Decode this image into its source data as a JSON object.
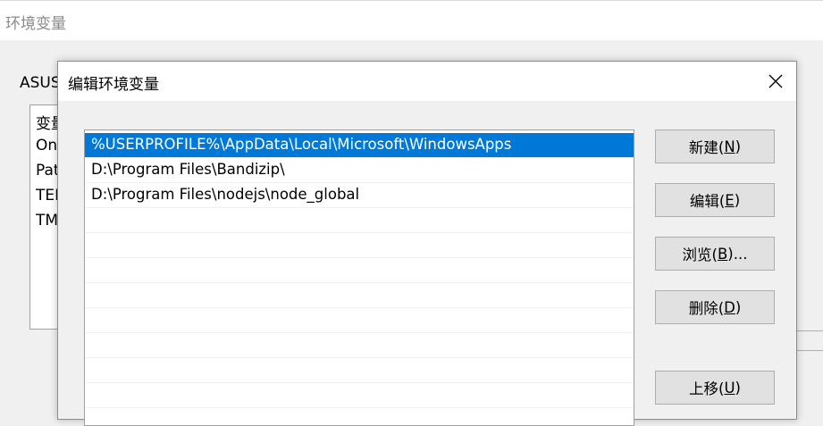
{
  "background_window": {
    "title": "环境变量",
    "user_section_label": "ASUS",
    "list_rows": [
      "变量",
      "On",
      "Pat",
      "TEI",
      "TM"
    ]
  },
  "dialog": {
    "title": "编辑环境变量",
    "paths": [
      "%USERPROFILE%\\AppData\\Local\\Microsoft\\WindowsApps",
      "D:\\Program Files\\Bandizip\\",
      "D:\\Program Files\\nodejs\\node_global"
    ],
    "selected_index": 0,
    "empty_rows": 8,
    "buttons": {
      "new": {
        "label": "新建(",
        "key": "N",
        "suffix": ")"
      },
      "edit": {
        "label": "编辑(",
        "key": "E",
        "suffix": ")"
      },
      "browse": {
        "label": "浏览(",
        "key": "B",
        "suffix": ")..."
      },
      "delete": {
        "label": "删除(",
        "key": "D",
        "suffix": ")"
      },
      "move_up": {
        "label": "上移(",
        "key": "U",
        "suffix": ")"
      }
    }
  },
  "colors": {
    "selection": "#0078d7",
    "button_bg": "#e1e1e1",
    "window_bg": "#f0f0f0"
  }
}
